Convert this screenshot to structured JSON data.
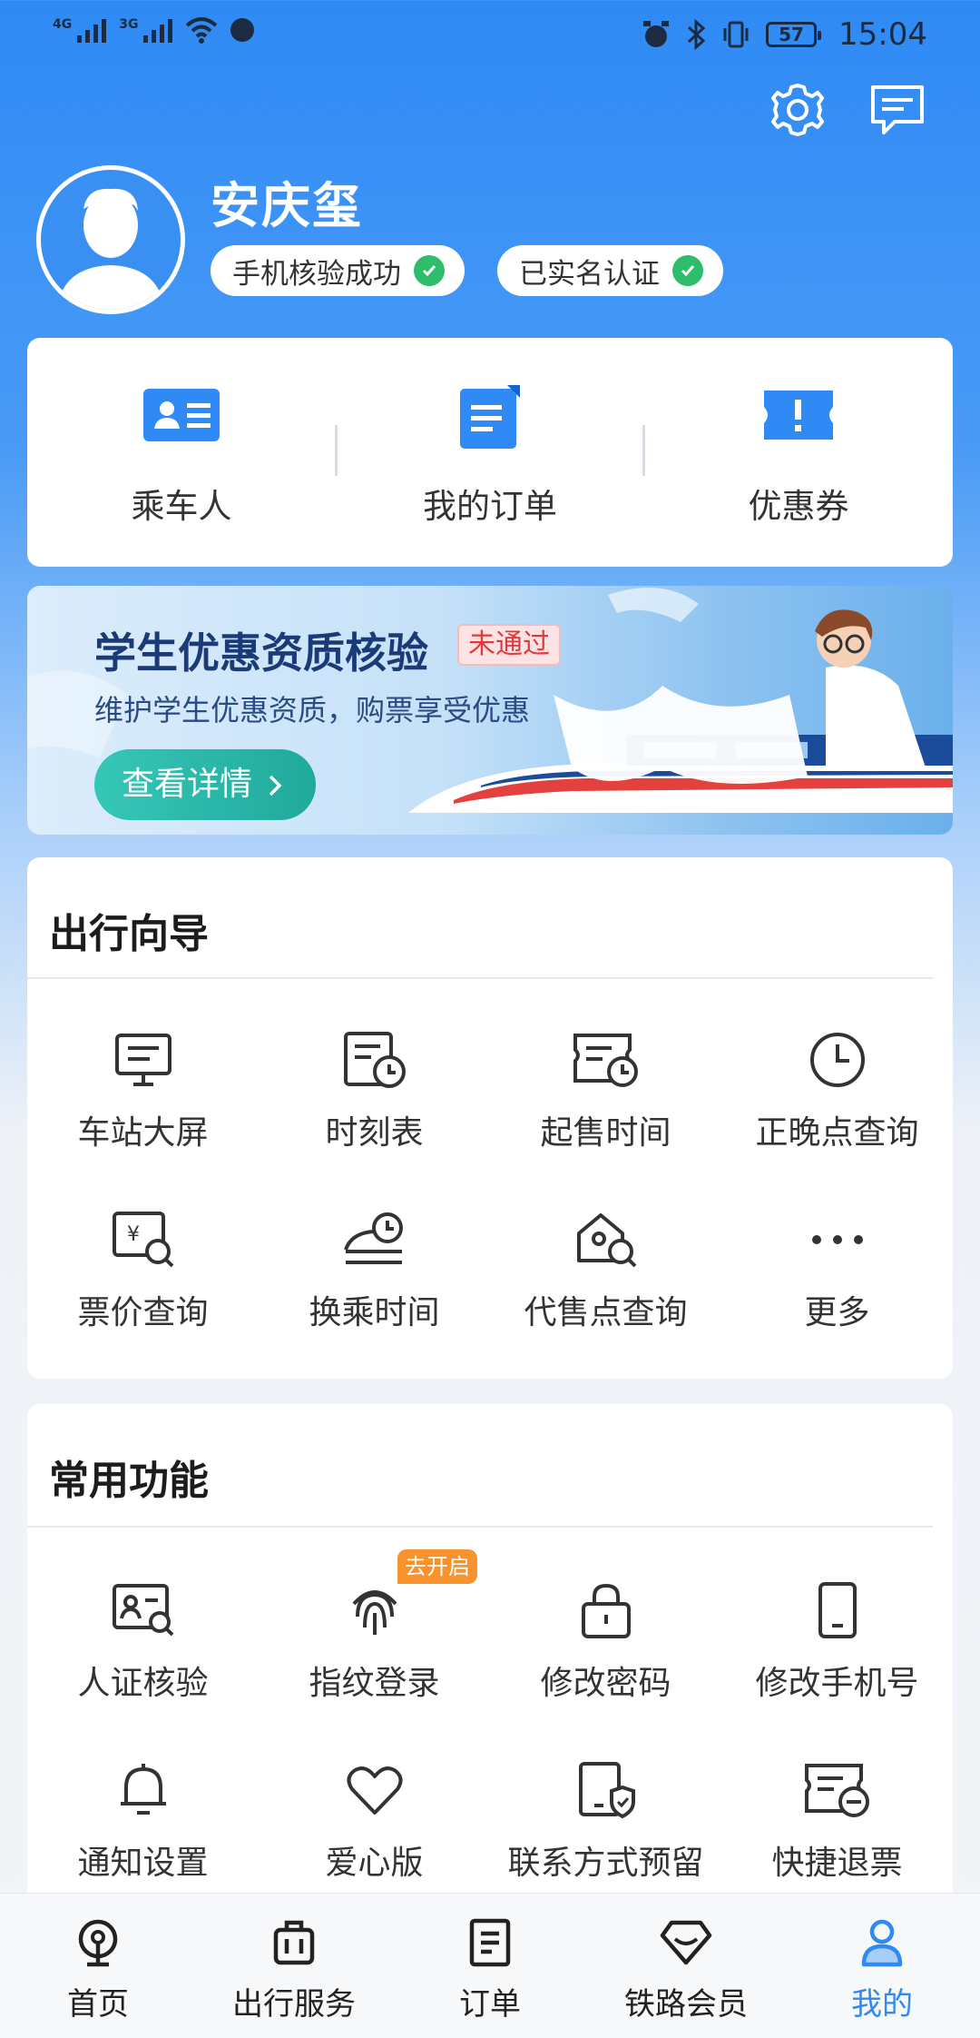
{
  "status_bar": {
    "net1": "4G",
    "net2": "3G",
    "battery": "57",
    "time": "15:04"
  },
  "header": {
    "settings_icon": "gear-icon",
    "message_icon": "message-icon"
  },
  "profile": {
    "name": "安庆玺",
    "badges": [
      {
        "label": "手机核验成功",
        "icon": "check-icon"
      },
      {
        "label": "已实名认证",
        "icon": "check-icon"
      }
    ]
  },
  "quick_links": [
    {
      "label": "乘车人",
      "icon": "passenger-card-icon"
    },
    {
      "label": "我的订单",
      "icon": "order-doc-icon"
    },
    {
      "label": "优惠券",
      "icon": "coupon-icon"
    }
  ],
  "banner": {
    "title": "学生优惠资质核验",
    "tag": "未通过",
    "subtitle": "维护学生优惠资质，购票享受优惠",
    "button": "查看详情"
  },
  "travel_guide": {
    "title": "出行向导",
    "items": [
      {
        "label": "车站大屏",
        "icon": "station-screen-icon"
      },
      {
        "label": "时刻表",
        "icon": "timetable-icon"
      },
      {
        "label": "起售时间",
        "icon": "sale-time-icon"
      },
      {
        "label": "正晚点查询",
        "icon": "clock-icon"
      },
      {
        "label": "票价查询",
        "icon": "fare-search-icon"
      },
      {
        "label": "换乘时间",
        "icon": "transfer-time-icon"
      },
      {
        "label": "代售点查询",
        "icon": "agency-search-icon"
      },
      {
        "label": "更多",
        "icon": "more-icon"
      }
    ]
  },
  "common_functions": {
    "title": "常用功能",
    "fingerprint_tag": "去开启",
    "items": [
      {
        "label": "人证核验",
        "icon": "id-verify-icon"
      },
      {
        "label": "指纹登录",
        "icon": "fingerprint-icon"
      },
      {
        "label": "修改密码",
        "icon": "lock-icon"
      },
      {
        "label": "修改手机号",
        "icon": "phone-icon"
      },
      {
        "label": "通知设置",
        "icon": "bell-icon"
      },
      {
        "label": "爱心版",
        "icon": "heart-icon"
      },
      {
        "label": "联系方式预留",
        "icon": "contact-shield-icon"
      },
      {
        "label": "快捷退票",
        "icon": "quick-refund-icon"
      }
    ]
  },
  "tab_bar": {
    "active": "我的",
    "tabs": [
      {
        "label": "首页",
        "icon": "rail-home-icon"
      },
      {
        "label": "出行服务",
        "icon": "luggage-icon"
      },
      {
        "label": "订单",
        "icon": "order-list-icon"
      },
      {
        "label": "铁路会员",
        "icon": "diamond-icon"
      },
      {
        "label": "我的",
        "icon": "user-icon"
      }
    ]
  },
  "colors": {
    "primary": "#2f8af5",
    "success": "#2ebd6b",
    "warning": "#f7922c",
    "danger": "#e03a3a"
  }
}
